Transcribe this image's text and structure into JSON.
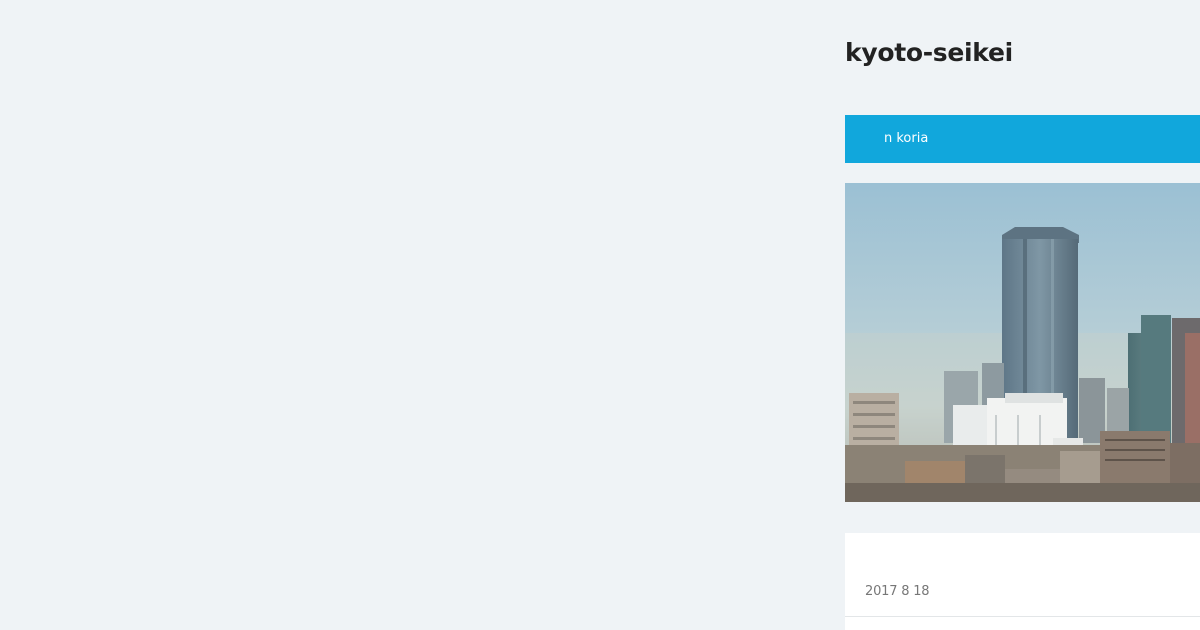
{
  "site": {
    "title": "kyoto-seikei"
  },
  "nav": {
    "items": [
      {
        "label": "n koria"
      }
    ],
    "color": "#11a7dc"
  },
  "hero": {
    "image_subject": "city-skyline-image"
  },
  "post": {
    "date": "2017  8  18"
  },
  "colors": {
    "background": "#eff3f6",
    "accent": "#11a7dc",
    "title": "#222222"
  }
}
